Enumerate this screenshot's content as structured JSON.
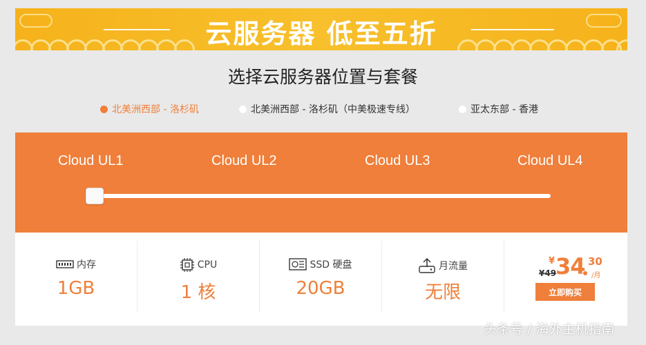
{
  "banner": {
    "title": "云服务器 低至五折"
  },
  "heading": "选择云服务器位置与套餐",
  "regions": [
    {
      "label": "北美洲西部 - 洛杉矶",
      "active": true
    },
    {
      "label": "北美洲西部 - 洛杉矶（中美极速专线）",
      "active": false
    },
    {
      "label": "亚太东部 - 香港",
      "active": false
    }
  ],
  "plans": [
    "Cloud UL1",
    "Cloud UL2",
    "Cloud UL3",
    "Cloud UL4"
  ],
  "slider": {
    "selected_index": 0
  },
  "specs": [
    {
      "icon": "memory-icon",
      "label": "内存",
      "value": "1GB"
    },
    {
      "icon": "cpu-icon",
      "label": "CPU",
      "value": "1 核"
    },
    {
      "icon": "ssd-icon",
      "label": "SSD 硬盘",
      "value": "20GB"
    },
    {
      "icon": "traffic-icon",
      "label": "月流量",
      "value": "无限"
    }
  ],
  "price": {
    "old": "¥49",
    "currency": "¥",
    "integer": "34",
    "decimal": "30",
    "period": "/月",
    "buy_label": "立即购买"
  },
  "watermark": "头条号 / 海外主机指南",
  "colors": {
    "accent": "#ef7f3a",
    "banner": "#f6b21b"
  }
}
